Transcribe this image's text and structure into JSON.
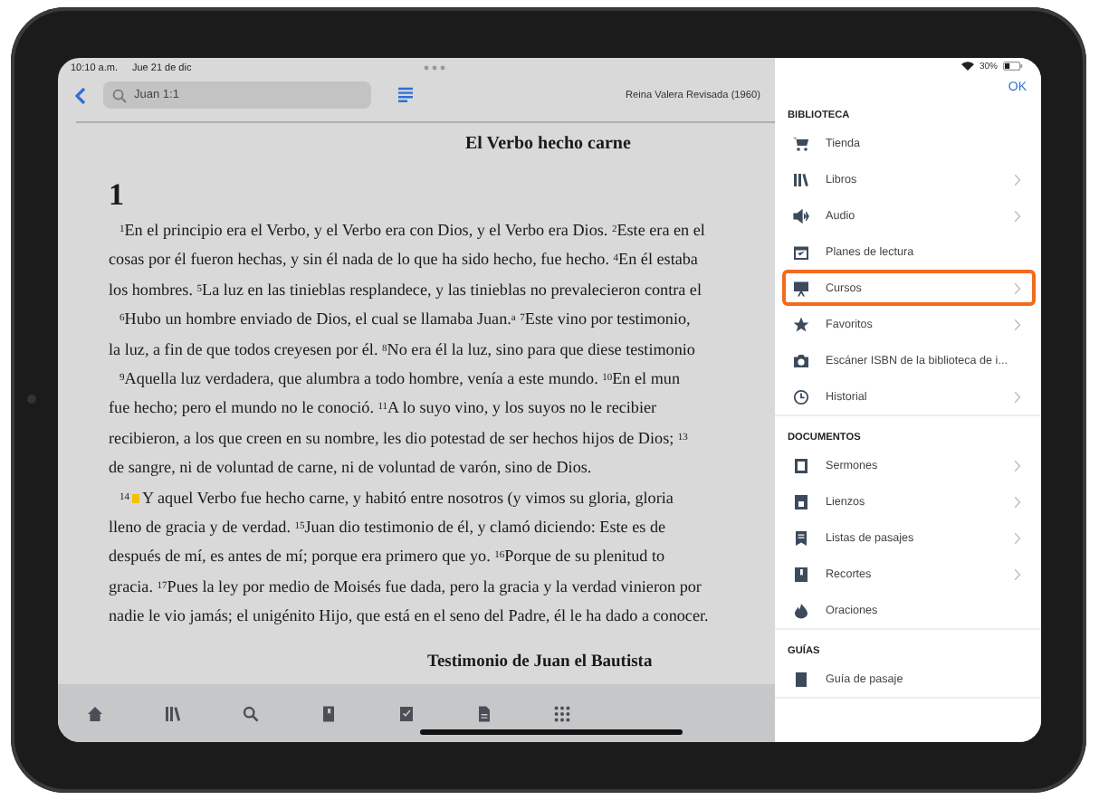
{
  "status_bar": {
    "time": "10:10 a.m.",
    "date": "Jue 21 de dic",
    "battery": "30%"
  },
  "toolbar": {
    "search": {
      "value": "Juan 1:1"
    },
    "version": "Reina Valera Revisada (1960)"
  },
  "reader": {
    "title": "El Verbo hecho carne",
    "chapter": "1",
    "paragraphs": [
      {
        "marked": false,
        "lines": [
          "$^{1}$En el principio era el Verbo, y el Verbo era con Dios, y el Verbo era Dios. $^{2}$Este era en el",
          "cosas por él fueron hechas, y sin él nada de lo que ha sido hecho, fue hecho. $^{4}$En él estaba",
          "los hombres. $^{5}$La luz en las tinieblas resplandece, y las tinieblas no prevalecieron contra el"
        ]
      },
      {
        "marked": false,
        "lines": [
          "$^{6}$Hubo un hombre enviado de Dios, el cual se llamaba Juan.$^{a}$ $^{7}$Este vino por testimonio,",
          "la luz, a fin de que todos creyesen por él. $^{8}$No era él la luz, sino para que diese testimonio"
        ]
      },
      {
        "marked": false,
        "lines": [
          "$^{9}$Aquella luz verdadera, que alumbra a todo hombre, venía a este mundo. $^{10}$En el mun",
          "fue hecho; pero el mundo no le conoció. $^{11}$A lo suyo vino, y los suyos no le recibier",
          "recibieron, a los que creen en su nombre, les dio potestad de ser hechos hijos de Dios; $^{13}$",
          "de sangre, ni de voluntad de carne, ni de voluntad de varón, sino de Dios."
        ]
      },
      {
        "marked": true,
        "verse": "14",
        "lines": [
          "Y aquel Verbo fue hecho carne, y habitó entre nosotros (y vimos su gloria, gloria",
          "lleno de gracia y de verdad. $^{15}$Juan dio testimonio de él, y clamó diciendo: Este es de",
          "después de mí, es antes de mí; porque era primero que yo. $^{16}$Porque de su plenitud to",
          "gracia. $^{17}$Pues la ley por medio de Moisés fue dada, pero la gracia y la verdad vinieron por",
          "nadie le vio jamás; el unigénito Hijo, que está en el seno del Padre, él le ha dado a conocer."
        ]
      }
    ],
    "next_heading": "Testimonio de Juan el Bautista"
  },
  "panel": {
    "done": "OK",
    "sections": [
      {
        "title": "BIBLIOTECA",
        "items": [
          {
            "label": "Tienda",
            "chevron": false,
            "highlighted": false
          },
          {
            "label": "Libros",
            "chevron": true,
            "highlighted": false
          },
          {
            "label": "Audio",
            "chevron": true,
            "highlighted": false
          },
          {
            "label": "Planes de lectura",
            "chevron": false,
            "highlighted": false
          },
          {
            "label": "Cursos",
            "chevron": true,
            "highlighted": true
          },
          {
            "label": "Favoritos",
            "chevron": true,
            "highlighted": false
          },
          {
            "label": "Escáner ISBN de la biblioteca de i...",
            "chevron": false,
            "highlighted": false
          },
          {
            "label": "Historial",
            "chevron": true,
            "highlighted": false
          }
        ]
      },
      {
        "title": "DOCUMENTOS",
        "items": [
          {
            "label": "Sermones",
            "chevron": true,
            "highlighted": false
          },
          {
            "label": "Lienzos",
            "chevron": true,
            "highlighted": false
          },
          {
            "label": "Listas de pasajes",
            "chevron": true,
            "highlighted": false
          },
          {
            "label": "Recortes",
            "chevron": true,
            "highlighted": false
          },
          {
            "label": "Oraciones",
            "chevron": false,
            "highlighted": false
          }
        ]
      },
      {
        "title": "GUÍAS",
        "items": [
          {
            "label": "Guía de pasaje",
            "chevron": false,
            "highlighted": false
          }
        ]
      }
    ]
  }
}
